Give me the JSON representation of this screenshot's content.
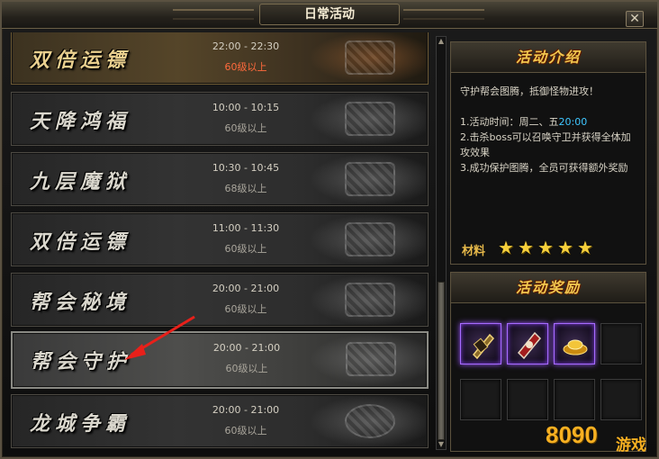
{
  "window": {
    "title": "日常活动",
    "close_label": "✕"
  },
  "activities": [
    {
      "name": "双倍运镖",
      "time": "22:00 - 22:30",
      "level": "60级以上",
      "style": "gold"
    },
    {
      "name": "天降鸿福",
      "time": "10:00 - 10:15",
      "level": "60级以上",
      "style": "normal"
    },
    {
      "name": "九层魔狱",
      "time": "10:30 - 10:45",
      "level": "68级以上",
      "style": "normal"
    },
    {
      "name": "双倍运镖",
      "time": "11:00 - 11:30",
      "level": "60级以上",
      "style": "normal"
    },
    {
      "name": "帮会秘境",
      "time": "20:00 - 21:00",
      "level": "60级以上",
      "style": "normal"
    },
    {
      "name": "帮会守护",
      "time": "20:00 - 21:00",
      "level": "60级以上",
      "style": "selected"
    },
    {
      "name": "龙城争霸",
      "time": "20:00 - 21:00",
      "level": "60级以上",
      "style": "normal"
    }
  ],
  "intro": {
    "header": "活动介绍",
    "summary": "守护帮会图腾，抵御怪物进攻！",
    "item1_prefix": "1.活动时间：周二、五",
    "item1_time": "20:00",
    "item2": "2.击杀boss可以召唤守卫并获得全体加攻效果",
    "item3": "3.成功保护图腾，全员可获得额外奖励",
    "material_label": "材料",
    "material_stars": 5,
    "star_glyph": "★"
  },
  "rewards": {
    "header": "活动奖励",
    "items": [
      {
        "icon": "sword-token-icon",
        "filled": true
      },
      {
        "icon": "red-scroll-icon",
        "filled": true
      },
      {
        "icon": "gold-ingot-icon",
        "filled": true
      },
      {
        "icon": "",
        "filled": false
      },
      {
        "icon": "",
        "filled": false
      },
      {
        "icon": "",
        "filled": false
      },
      {
        "icon": "",
        "filled": false
      },
      {
        "icon": "",
        "filled": false
      }
    ]
  },
  "watermark": {
    "brand_number": "8090",
    "brand_cn": "游戏"
  },
  "colors": {
    "gold_text": "#e9cf8e",
    "level_highlight": "#ff6a3c",
    "header_yellow": "#f1c74f",
    "time_cyan": "#3fc6ff",
    "arrow_red": "#e8201a",
    "epic_purple": "#a66bff"
  }
}
